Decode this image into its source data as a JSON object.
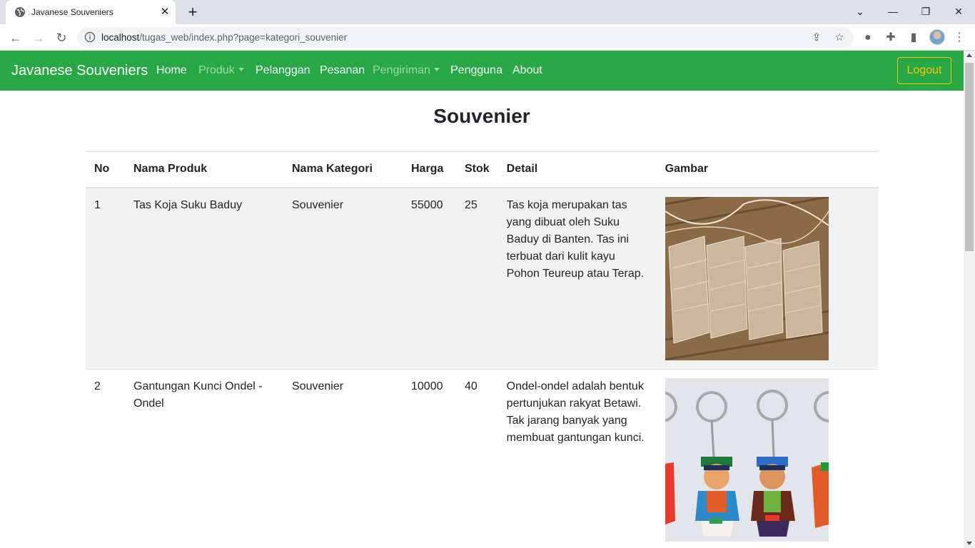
{
  "browser": {
    "tab_title": "Javanese Souveniers",
    "url_host": "localhost",
    "url_path": "/tugas_web/index.php?page=kategori_souvenier"
  },
  "navbar": {
    "brand": "Javanese Souveniers",
    "links": [
      "Home",
      "Produk",
      "Pelanggan",
      "Pesanan",
      "Pengiriman",
      "Pengguna",
      "About"
    ],
    "logout_label": "Logout",
    "color": "#28a745",
    "logout_color": "#ffc107"
  },
  "page": {
    "title": "Souvenier"
  },
  "table": {
    "headers": [
      "No",
      "Nama Produk",
      "Nama Kategori",
      "Harga",
      "Stok",
      "Detail",
      "Gambar"
    ],
    "rows": [
      {
        "no": "1",
        "nama_produk": "Tas Koja Suku Baduy",
        "kategori": "Souvenier",
        "harga": "55000",
        "stok": "25",
        "detail": "Tas koja merupakan tas yang dibuat oleh Suku Baduy di Banten. Tas ini terbuat dari kulit kayu Pohon Teureup atau Terap.",
        "image": "tas-koja-photo"
      },
      {
        "no": "2",
        "nama_produk": "Gantungan Kunci Ondel - Ondel",
        "kategori": "Souvenier",
        "harga": "10000",
        "stok": "40",
        "detail": "Ondel-ondel adalah bentuk pertunjukan rakyat Betawi. Tak jarang banyak yang membuat gantungan kunci.",
        "image": "ondel-keychain-photo"
      }
    ]
  }
}
